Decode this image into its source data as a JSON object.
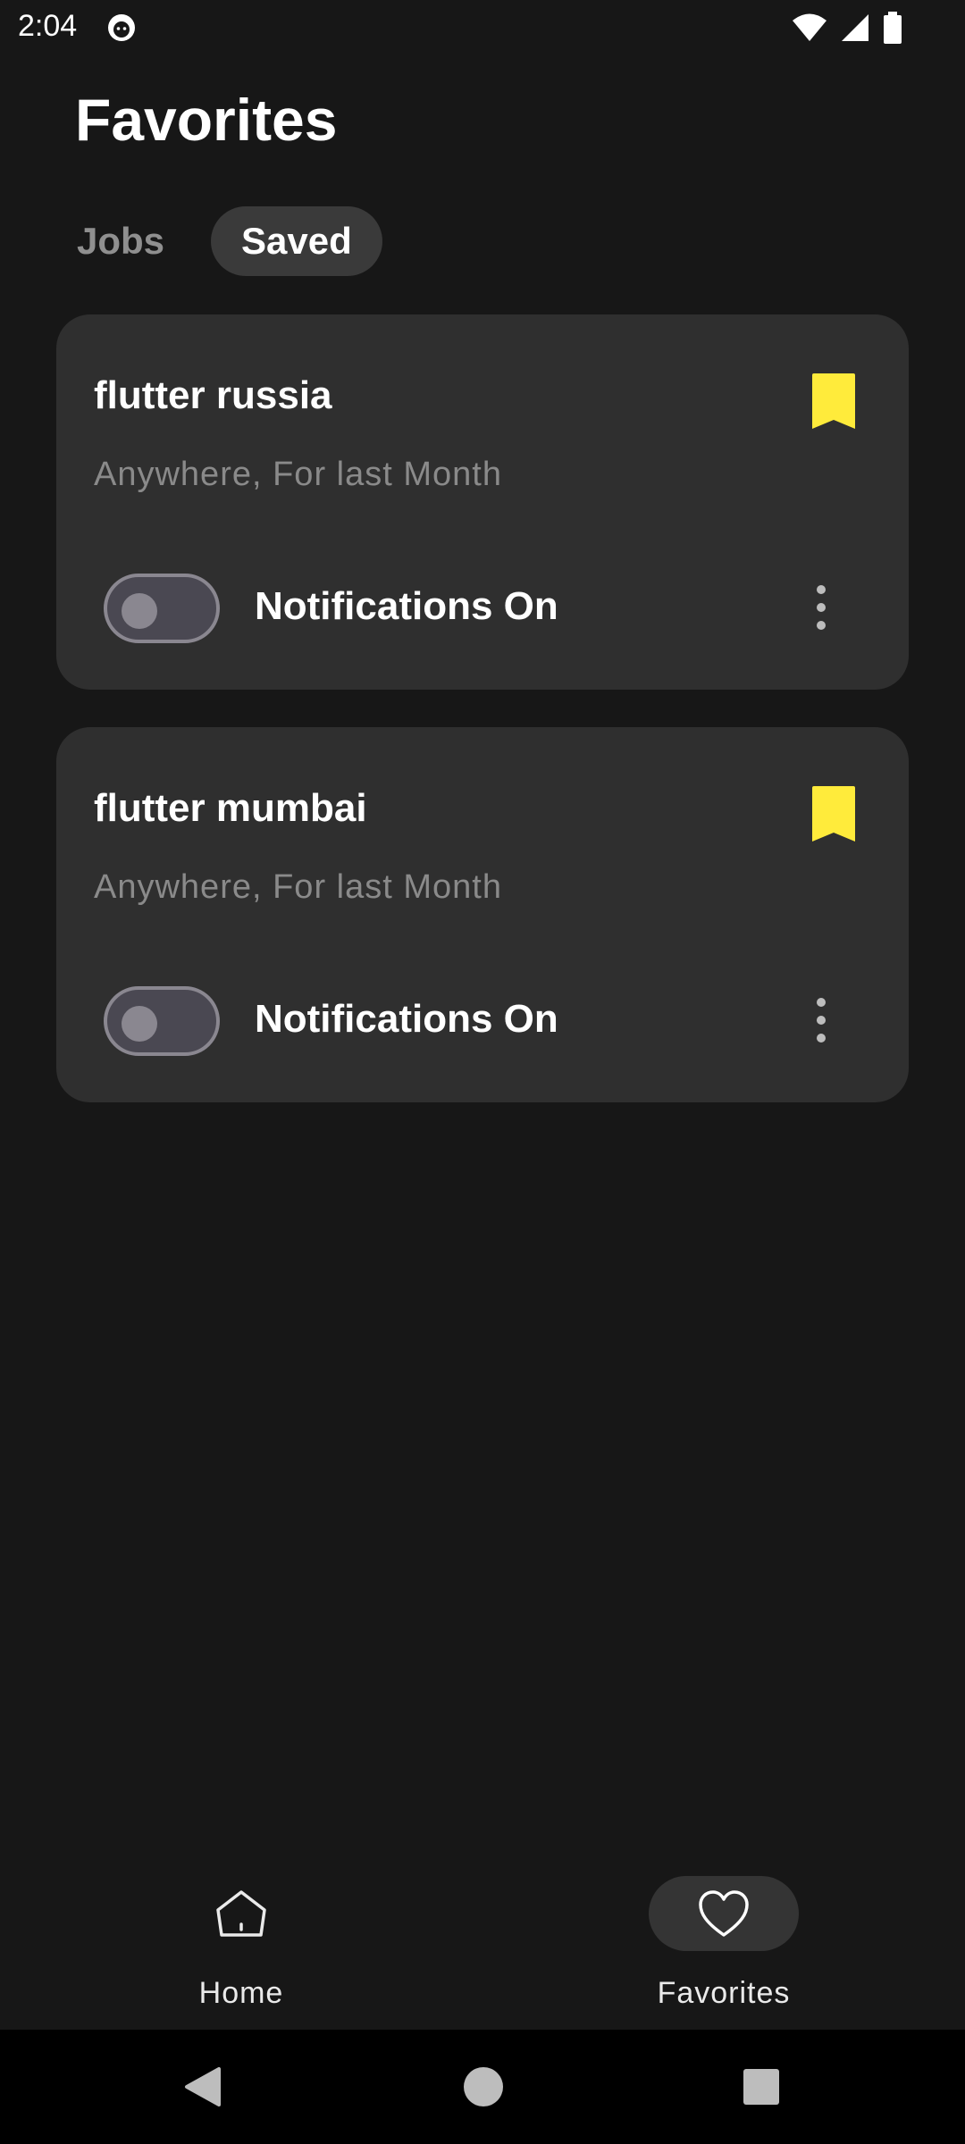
{
  "status_bar": {
    "time": "2:04",
    "icons": [
      "cat-notification-icon",
      "wifi-icon",
      "signal-icon",
      "battery-icon"
    ]
  },
  "page": {
    "title": "Favorites"
  },
  "tabs": [
    {
      "label": "Jobs",
      "active": false
    },
    {
      "label": "Saved",
      "active": true
    }
  ],
  "cards": [
    {
      "title": "flutter russia",
      "subtitle": "Anywhere, For last Month",
      "notification_label": "Notifications On",
      "toggle_on": false,
      "bookmarked": true
    },
    {
      "title": "flutter mumbai",
      "subtitle": "Anywhere, For last Month",
      "notification_label": "Notifications On",
      "toggle_on": false,
      "bookmarked": true
    }
  ],
  "bottom_nav": {
    "items": [
      {
        "label": "Home",
        "icon": "home-icon",
        "active": false
      },
      {
        "label": "Favorites",
        "icon": "heart-icon",
        "active": true
      }
    ]
  },
  "colors": {
    "background": "#171717",
    "card": "#2f2f2f",
    "bookmark": "#ffeb3b",
    "muted_text": "#8a8a8a"
  }
}
